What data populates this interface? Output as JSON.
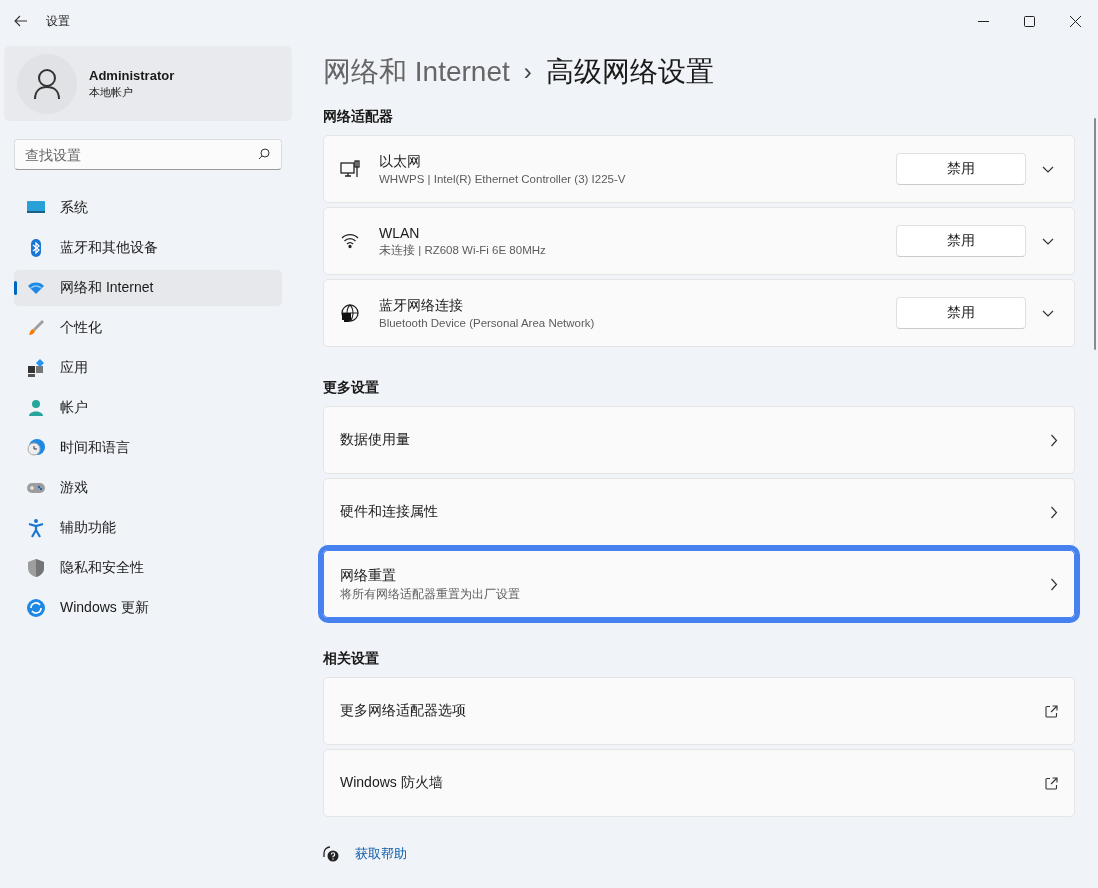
{
  "window": {
    "title": "设置"
  },
  "account": {
    "name": "Administrator",
    "type": "本地帐户"
  },
  "search": {
    "placeholder": "查找设置"
  },
  "nav": [
    {
      "label": "系统",
      "selected": false
    },
    {
      "label": "蓝牙和其他设备",
      "selected": false
    },
    {
      "label": "网络和 Internet",
      "selected": true
    },
    {
      "label": "个性化",
      "selected": false
    },
    {
      "label": "应用",
      "selected": false
    },
    {
      "label": "帐户",
      "selected": false
    },
    {
      "label": "时间和语言",
      "selected": false
    },
    {
      "label": "游戏",
      "selected": false
    },
    {
      "label": "辅助功能",
      "selected": false
    },
    {
      "label": "隐私和安全性",
      "selected": false
    },
    {
      "label": "Windows 更新",
      "selected": false
    }
  ],
  "breadcrumb": {
    "parent": "网络和 Internet",
    "separator": "›",
    "current": "高级网络设置"
  },
  "adapters_section": {
    "title": "网络适配器",
    "adapters": [
      {
        "kind": "ethernet",
        "name": "以太网",
        "description": "WHWPS | Intel(R) Ethernet Controller (3) I225-V",
        "button": "禁用",
        "expanded": false
      },
      {
        "kind": "wifi",
        "name": "WLAN",
        "description": "未连接 | RZ608 Wi-Fi 6E 80MHz",
        "button": "禁用",
        "expanded": false
      },
      {
        "kind": "globe",
        "name": "蓝牙网络连接",
        "description": "Bluetooth Device (Personal Area Network)",
        "button": "禁用",
        "expanded": false
      }
    ]
  },
  "more_section": {
    "title": "更多设置",
    "items": [
      {
        "kind": "chevron",
        "label": "数据使用量",
        "highlighted": false
      },
      {
        "kind": "chevron",
        "label": "硬件和连接属性",
        "highlighted": false
      },
      {
        "kind": "chevron",
        "label": "网络重置",
        "description": "将所有网络适配器重置为出厂设置",
        "highlighted": true
      }
    ]
  },
  "related_section": {
    "title": "相关设置",
    "items": [
      {
        "kind": "external",
        "label": "更多网络适配器选项",
        "highlighted": false
      },
      {
        "kind": "external",
        "label": "Windows 防火墙",
        "highlighted": false
      }
    ]
  },
  "help_link": "获取帮助"
}
